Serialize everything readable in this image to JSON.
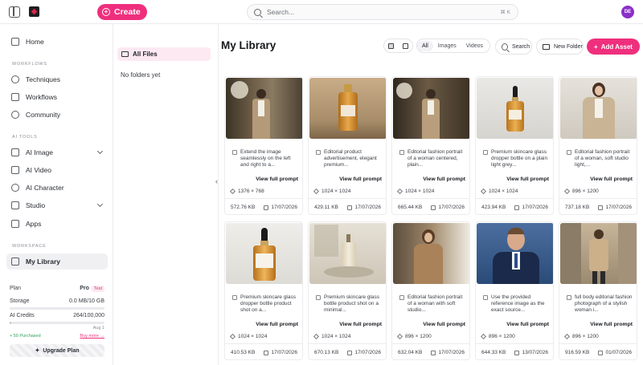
{
  "topbar": {
    "create_label": "Create",
    "search_placeholder": "Search...",
    "search_shortcut": "⌘ K",
    "avatar_initials": "DE"
  },
  "sidebar": {
    "items_top": [
      {
        "label": "Home",
        "icon": "home-icon"
      }
    ],
    "sections": [
      {
        "label": "WORKFLOWS"
      },
      {
        "label": "AI TOOLS"
      },
      {
        "label": "WORKSPACE"
      }
    ],
    "workflows": [
      {
        "label": "Techniques",
        "icon": "techniques-icon"
      },
      {
        "label": "Workflows",
        "icon": "workflows-icon"
      },
      {
        "label": "Community",
        "icon": "community-icon"
      }
    ],
    "ai_tools": [
      {
        "label": "AI Image",
        "icon": "image-icon",
        "expandable": true
      },
      {
        "label": "AI Video",
        "icon": "video-icon"
      },
      {
        "label": "AI Character",
        "icon": "character-icon"
      },
      {
        "label": "Studio",
        "icon": "studio-icon",
        "expandable": true
      },
      {
        "label": "Apps",
        "icon": "apps-icon"
      }
    ],
    "workspace": [
      {
        "label": "My Library",
        "icon": "library-icon",
        "active": true
      }
    ],
    "plan": {
      "plan_label": "Plan",
      "plan_value": "Pro",
      "plan_badge": "Test",
      "storage_label": "Storage",
      "storage_value": "0.0 MB/10 GB",
      "storage_fraction": 0.0,
      "credits_label": "AI Credits",
      "credits_value": "264/100,000",
      "credits_fraction": 0.003,
      "renew_date": "Aug 1",
      "purchased_label": "+ 50 Purchased",
      "buy_more_label": "Buy more →",
      "upgrade_label": "Upgrade Plan"
    }
  },
  "files_panel": {
    "all_files_label": "All Files",
    "empty_label": "No folders yet"
  },
  "main": {
    "title": "My Library",
    "filters": [
      "All",
      "Images",
      "Videos"
    ],
    "active_filter": "All",
    "search_label": "Search",
    "new_folder_label": "New Folder",
    "add_asset_label": "Add Asset",
    "view_full_prompt": "View full prompt",
    "assets": [
      {
        "desc": "Extend the image seamlessly on the left and right to a...",
        "dims": "1376 × 768",
        "size": "572.76 KB",
        "date": "17/07/2026",
        "thumb": "woman-beige-suit-studio-wide"
      },
      {
        "desc": "Editorial product advertisement, elegant premium...",
        "dims": "1024 × 1024",
        "size": "429.11 KB",
        "date": "17/07/2026",
        "thumb": "amber-serum-bottle"
      },
      {
        "desc": "Editorial fashion portrait of a woman centered, plain...",
        "dims": "1024 × 1024",
        "size": "665.44 KB",
        "date": "17/07/2026",
        "thumb": "woman-beige-suit-studio"
      },
      {
        "desc": "Premium skincare glass dropper bottle on a plain light grey...",
        "dims": "1024 × 1024",
        "size": "423.94 KB",
        "date": "17/07/2026",
        "thumb": "dropper-bottle-grey"
      },
      {
        "desc": "Editorial fashion portrait of a woman, soft studio light,...",
        "dims": "896 × 1200",
        "size": "737.18 KB",
        "date": "17/07/2026",
        "thumb": "woman-blazer-portrait"
      },
      {
        "desc": "Premium skincare glass dropper bottle product shot on a...",
        "dims": "1024 × 1024",
        "size": "410.53 KB",
        "date": "17/07/2026",
        "thumb": "dropper-bottle-label"
      },
      {
        "desc": "Premium skincare glass bottle product shot on a minimal...",
        "dims": "1024 × 1024",
        "size": "670.13 KB",
        "date": "17/07/2026",
        "thumb": "bottle-minimal-stone"
      },
      {
        "desc": "Editorial fashion portrait of a woman with soft studio...",
        "dims": "896 × 1200",
        "size": "632.04 KB",
        "date": "17/07/2026",
        "thumb": "woman-studio-soft"
      },
      {
        "desc": "Use the provided reference image as the exact source...",
        "dims": "896 × 1200",
        "size": "644.33 KB",
        "date": "13/07/2026",
        "thumb": "man-navy-suit"
      },
      {
        "desc": "full body editorial fashion photograph of a stylish woman i...",
        "dims": "896 × 1200",
        "size": "916.59 KB",
        "date": "01/07/2026",
        "thumb": "woman-street-trench"
      }
    ]
  },
  "colors": {
    "accent": "#ef2f7d",
    "accent_soft": "#fde9f1",
    "avatar": "#8b2fc9"
  }
}
